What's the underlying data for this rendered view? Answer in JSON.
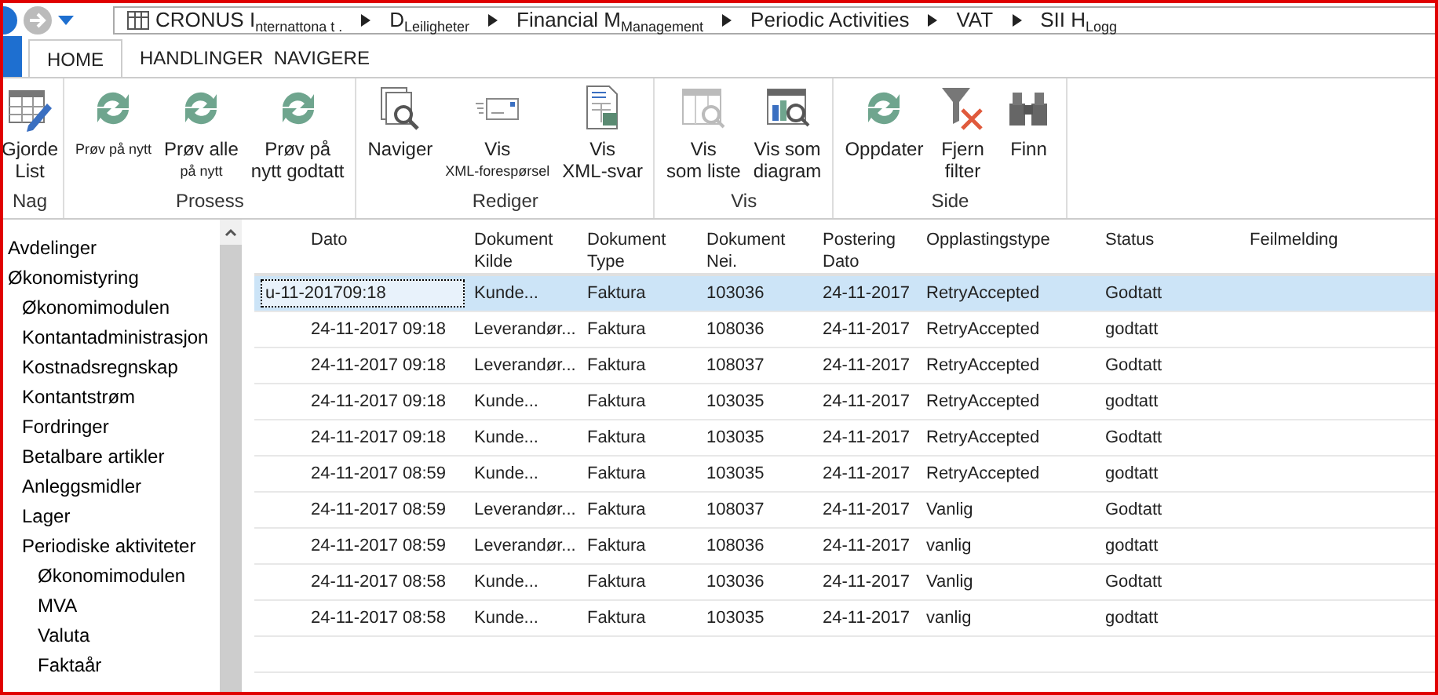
{
  "breadcrumb": [
    "CRONUS I$_{nternattona t .}$",
    "D$_{Leiligheter}$",
    "Financial M$_{Management}$",
    "Periodic Activities",
    "VAT",
    "SII H$_{Logg}$"
  ],
  "tabs": [
    {
      "label": "HOME",
      "selected": true
    },
    {
      "label": "HANDLINGER  NAVIGERE",
      "selected": false
    }
  ],
  "ribbon": [
    {
      "label": "Nag",
      "buttons": [
        {
          "kind": "edit",
          "lines": [
            {
              "text": "Gjorde",
              "small": false
            },
            {
              "text": "List",
              "small": false
            }
          ]
        }
      ]
    },
    {
      "label": "Prosess",
      "buttons": [
        {
          "kind": "refresh",
          "lines": [
            {
              "text": "Prøv på nytt",
              "small": true
            }
          ]
        },
        {
          "kind": "refresh",
          "lines": [
            {
              "text": "Prøv alle",
              "small": false
            },
            {
              "text": "på nytt",
              "small": true
            }
          ]
        },
        {
          "kind": "refresh",
          "lines": [
            {
              "text": "Prøv på",
              "small": false
            },
            {
              "text": "nytt godtatt",
              "small": false
            }
          ]
        }
      ]
    },
    {
      "label": "Rediger",
      "buttons": [
        {
          "kind": "navigate",
          "lines": [
            {
              "text": "Naviger",
              "small": false
            }
          ]
        },
        {
          "kind": "envelope",
          "lines": [
            {
              "text": "Vis",
              "small": false
            },
            {
              "text": "XML-forespørsel",
              "small": true
            }
          ]
        },
        {
          "kind": "document",
          "lines": [
            {
              "text": "Vis",
              "small": false
            },
            {
              "text": "XML-svar",
              "small": false
            }
          ]
        }
      ]
    },
    {
      "label": "Vis",
      "buttons": [
        {
          "kind": "list",
          "lines": [
            {
              "text": "Vis",
              "small": false
            },
            {
              "text": "som liste",
              "small": false
            }
          ]
        },
        {
          "kind": "chart",
          "lines": [
            {
              "text": "Vis som",
              "small": false
            },
            {
              "text": "diagram",
              "small": false
            }
          ]
        }
      ]
    },
    {
      "label": "Side",
      "buttons": [
        {
          "kind": "refresh",
          "lines": [
            {
              "text": "Oppdater",
              "small": false
            }
          ]
        },
        {
          "kind": "filter",
          "lines": [
            {
              "text": "Fjern",
              "small": false
            },
            {
              "text": "filter",
              "small": false
            }
          ]
        },
        {
          "kind": "binoculars",
          "lines": [
            {
              "text": "Finn",
              "small": false
            }
          ]
        }
      ]
    }
  ],
  "sidebar": {
    "items": [
      {
        "label": "Avdelinger"
      },
      {
        "label": "Økonomistyring",
        "children": [
          {
            "label": "Økonomimodulen"
          },
          {
            "label": "Kontantadministrasjon"
          },
          {
            "label": "Kostnadsregnskap"
          },
          {
            "label": "Kontantstrøm"
          },
          {
            "label": "Fordringer"
          },
          {
            "label": "Betalbare artikler"
          },
          {
            "label": "Anleggsmidler"
          },
          {
            "label": "Lager"
          },
          {
            "label": "Periodiske aktiviteter",
            "children": [
              {
                "label": "Økonomimodulen"
              },
              {
                "label": "MVA"
              },
              {
                "label": "Valuta"
              },
              {
                "label": "Faktaår"
              }
            ]
          }
        ]
      }
    ]
  },
  "table": {
    "columns": [
      "Dato",
      "Dokument Kilde",
      "Dokument Type",
      "Dokument Nei.",
      "Postering Dato",
      "Opplastingstype",
      "Status",
      "Feilmelding"
    ],
    "rows": [
      {
        "selected": true,
        "cells": [
          "u-11-201709:18",
          "Kunde...",
          "Faktura",
          "103036",
          "24-11-2017",
          "RetryAccepted",
          "Godtatt"
        ]
      },
      {
        "selected": false,
        "cells": [
          "24-11-2017 09:18",
          "Leverandør...",
          "Faktura",
          "108036",
          "24-11-2017",
          "RetryAccepted",
          "godtatt"
        ]
      },
      {
        "selected": false,
        "cells": [
          "24-11-2017 09:18",
          "Leverandør...",
          "Faktura",
          "108037",
          "24-11-2017",
          "RetryAccepted",
          "Godtatt"
        ]
      },
      {
        "selected": false,
        "cells": [
          "24-11-2017 09:18",
          "Kunde...",
          "Faktura",
          "103035",
          "24-11-2017",
          "RetryAccepted",
          "godtatt"
        ]
      },
      {
        "selected": false,
        "cells": [
          "24-11-2017 09:18",
          "Kunde...",
          "Faktura",
          "103035",
          "24-11-2017",
          "RetryAccepted",
          "Godtatt"
        ]
      },
      {
        "selected": false,
        "cells": [
          "24-11-2017 08:59",
          "Kunde...",
          "Faktura",
          "103035",
          "24-11-2017",
          "RetryAccepted",
          "godtatt"
        ]
      },
      {
        "selected": false,
        "cells": [
          "24-11-2017 08:59",
          "Leverandør...",
          "Faktura",
          "108037",
          "24-11-2017",
          "Vanlig",
          "Godtatt"
        ]
      },
      {
        "selected": false,
        "cells": [
          "24-11-2017 08:59",
          "Leverandør...",
          "Faktura",
          "108036",
          "24-11-2017",
          "vanlig",
          "godtatt"
        ]
      },
      {
        "selected": false,
        "cells": [
          "24-11-2017 08:58",
          "Kunde...",
          "Faktura",
          "103036",
          "24-11-2017",
          "Vanlig",
          "Godtatt"
        ]
      },
      {
        "selected": false,
        "cells": [
          "24-11-2017 08:58",
          "Kunde...",
          "Faktura",
          "103035",
          "24-11-2017",
          "vanlig",
          "godtatt"
        ]
      }
    ]
  }
}
